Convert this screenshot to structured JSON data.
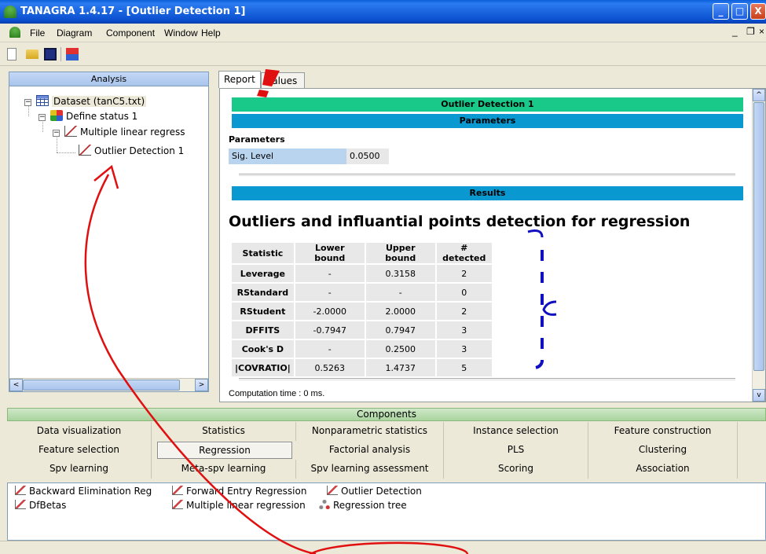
{
  "window": {
    "title": "TANAGRA 1.4.17 - [Outlier Detection 1]",
    "controls": {
      "minimize": "_",
      "maximize": "□",
      "close": "X"
    },
    "mdi_controls": {
      "minimize": "_",
      "restore": "❐",
      "close": "×"
    }
  },
  "menu": {
    "items": [
      "File",
      "Diagram",
      "Component",
      "Window",
      "Help"
    ]
  },
  "analysis": {
    "header": "Analysis",
    "tree": [
      {
        "label": "Dataset (tanC5.txt)",
        "icon": "dataset-icon"
      },
      {
        "label": "Define status 1",
        "icon": "define-status-icon"
      },
      {
        "label": "Multiple linear regress",
        "icon": "regression-icon"
      },
      {
        "label": "Outlier Detection 1",
        "icon": "outlier-icon"
      }
    ]
  },
  "tabs": {
    "report": "Report",
    "values": "Values"
  },
  "report": {
    "title_band": "Outlier Detection 1",
    "params_band": "Parameters",
    "params_label": "Parameters",
    "sig_label": "Sig. Level",
    "sig_value": "0.0500",
    "results_band": "Results",
    "heading": "Outliers and influantial points detection for regression",
    "table": {
      "headers": [
        "Statistic",
        "Lower bound",
        "Upper bound",
        "# detected"
      ],
      "rows": [
        [
          "Leverage",
          "-",
          "0.3158",
          "2"
        ],
        [
          "RStandard",
          "-",
          "-",
          "0"
        ],
        [
          "RStudent",
          "-2.0000",
          "2.0000",
          "2"
        ],
        [
          "DFFITS",
          "-0.7947",
          "0.7947",
          "3"
        ],
        [
          "Cook's D",
          "-",
          "0.2500",
          "3"
        ],
        [
          "|COVRATIO|",
          "0.5263",
          "1.4737",
          "5"
        ]
      ]
    },
    "computation": "Computation time : 0 ms."
  },
  "components": {
    "header": "Components",
    "tabs": [
      [
        "Data visualization",
        "Statistics",
        "Nonparametric statistics",
        "Instance selection",
        "Feature construction"
      ],
      [
        "Feature selection",
        "Regression",
        "Factorial analysis",
        "PLS",
        "Clustering"
      ],
      [
        "Spv learning",
        "Meta-spv learning",
        "Spv learning assessment",
        "Scoring",
        "Association"
      ]
    ],
    "selected_tab": "Regression",
    "list": [
      "Backward Elimination Reg",
      "Forward Entry Regression",
      "Outlier Detection",
      "DfBetas",
      "Multiple linear regression",
      "Regression tree"
    ]
  },
  "colors": {
    "green_band": "#19c98a",
    "blue_band": "#0a98d0",
    "annotation_red": "#e01010",
    "annotation_blue": "#1010c0"
  }
}
